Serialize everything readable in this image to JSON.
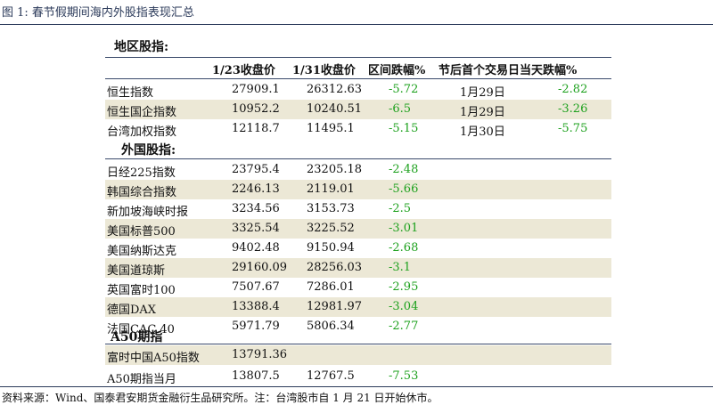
{
  "title": "图 1:  春节假期间海内外股指表现汇总",
  "source": "资料来源：Wind、国泰君安期货金融衍生品研究所。注：台湾股市自 1 月 21 日开始休市。",
  "colors": {
    "shade": "#ece8d6",
    "negative": "#1ea11e",
    "rule": "#2b3a5a"
  },
  "sections": {
    "region": "地区股指:",
    "foreign": "外国股指:",
    "a50": "A50期指"
  },
  "headers": {
    "close_123": "1/23收盘价",
    "close_131": "1/31收盘价",
    "range_change": "区间跌幅%",
    "first_day": "节后首个交易日当天跌幅%"
  },
  "region_rows": [
    {
      "name": "恒生指数",
      "c1": "27909.1",
      "c2": "26312.63",
      "chg": "-5.72",
      "date": "1月29日",
      "day_chg": "-2.82"
    },
    {
      "name": "恒生国企指数",
      "c1": "10952.2",
      "c2": "10240.51",
      "chg": "-6.5",
      "date": "1月29日",
      "day_chg": "-3.26"
    },
    {
      "name": "台湾加权指数",
      "c1": "12118.7",
      "c2": "11495.1",
      "chg": "-5.15",
      "date": "1月30日",
      "day_chg": "-5.75"
    }
  ],
  "foreign_rows": [
    {
      "name": "日经225指数",
      "c1": "23795.4",
      "c2": "23205.18",
      "chg": "-2.48"
    },
    {
      "name": "韩国综合指数",
      "c1": "2246.13",
      "c2": "2119.01",
      "chg": "-5.66"
    },
    {
      "name": "新加坡海峡时报",
      "c1": "3234.56",
      "c2": "3153.73",
      "chg": "-2.5"
    },
    {
      "name": "美国标普500",
      "c1": "3325.54",
      "c2": "3225.52",
      "chg": "-3.01"
    },
    {
      "name": "美国纳斯达克",
      "c1": "9402.48",
      "c2": "9150.94",
      "chg": "-2.68"
    },
    {
      "name": "美国道琼斯",
      "c1": "29160.09",
      "c2": "28256.03",
      "chg": "-3.1"
    },
    {
      "name": "英国富时100",
      "c1": "7507.67",
      "c2": "7286.01",
      "chg": "-2.95"
    },
    {
      "name": "德国DAX",
      "c1": "13388.4",
      "c2": "12981.97",
      "chg": "-3.04"
    },
    {
      "name": "法国CAC 40",
      "c1": "5971.79",
      "c2": "5806.34",
      "chg": "-2.77"
    }
  ],
  "a50_rows": [
    {
      "name": "富时中国A50指数",
      "c1": "13791.36",
      "c2": "",
      "chg": ""
    },
    {
      "name": "A50期指当月",
      "c1": "13807.5",
      "c2": "12767.5",
      "chg": "-7.53"
    }
  ]
}
